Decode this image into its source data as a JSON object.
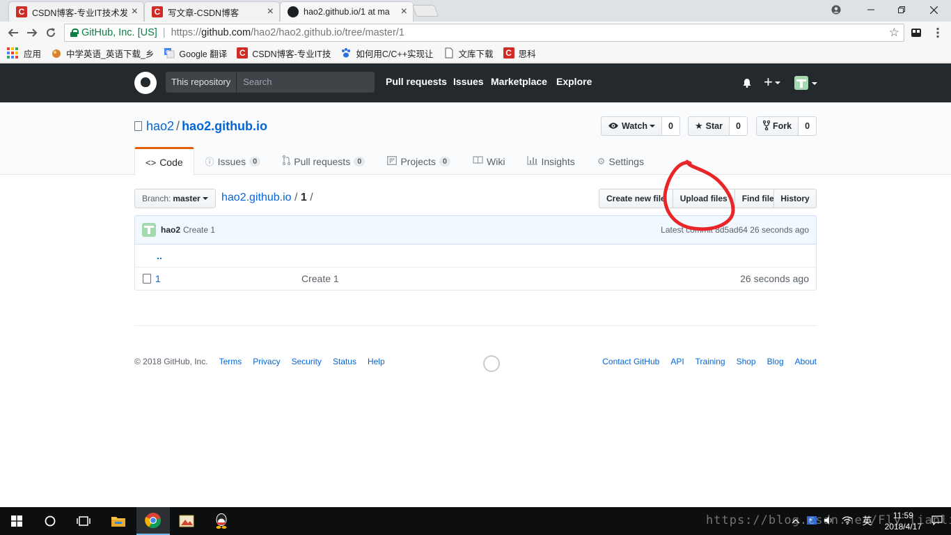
{
  "browser": {
    "tabs": [
      {
        "title": "CSDN博客-专业IT技术发",
        "favicon": "csdn-icon",
        "active": false
      },
      {
        "title": "写文章-CSDN博客",
        "favicon": "csdn-icon",
        "active": false
      },
      {
        "title": "hao2.github.io/1 at ma",
        "favicon": "github-icon",
        "active": true
      }
    ],
    "security_label": "GitHub, Inc. [US]",
    "url_scheme": "https://",
    "url_host": "github.com",
    "url_path": "/hao2/hao2.github.io/tree/master/1",
    "bookmarks": [
      {
        "label": "应用",
        "icon": "apps-grid-icon"
      },
      {
        "label": "中学英语_英语下载_乡",
        "icon": "bookmark-icon"
      },
      {
        "label": "Google 翻译",
        "icon": "google-translate-icon"
      },
      {
        "label": "CSDN博客-专业IT技",
        "icon": "csdn-icon"
      },
      {
        "label": "如何用C/C++实现让",
        "icon": "baidu-paw-icon"
      },
      {
        "label": "文库下载",
        "icon": "page-icon"
      },
      {
        "label": "思科",
        "icon": "csdn-icon"
      }
    ]
  },
  "header": {
    "scope_label": "This repository",
    "search_placeholder": "Search",
    "nav": [
      "Pull requests",
      "Issues",
      "Marketplace",
      "Explore"
    ]
  },
  "repo": {
    "owner": "hao2",
    "name": "hao2.github.io",
    "watch": {
      "label": "Watch",
      "count": "0"
    },
    "star": {
      "label": "Star",
      "count": "0"
    },
    "fork": {
      "label": "Fork",
      "count": "0"
    },
    "tabs": [
      {
        "label": "Code",
        "icon": "code-icon"
      },
      {
        "label": "Issues",
        "icon": "issue-icon",
        "count": "0"
      },
      {
        "label": "Pull requests",
        "icon": "pull-request-icon",
        "count": "0"
      },
      {
        "label": "Projects",
        "icon": "project-icon",
        "count": "0"
      },
      {
        "label": "Wiki",
        "icon": "book-icon"
      },
      {
        "label": "Insights",
        "icon": "graph-icon"
      },
      {
        "label": "Settings",
        "icon": "gear-icon"
      }
    ]
  },
  "filenav": {
    "branch_label": "Branch:",
    "branch": "master",
    "breadcrumb_root": "hao2.github.io",
    "breadcrumb_current": "1",
    "buttons": {
      "create": "Create new file",
      "upload": "Upload files",
      "find": "Find file",
      "history": "History"
    }
  },
  "commit": {
    "author": "hao2",
    "message": "Create 1",
    "latest_label": "Latest commit",
    "sha": "8d5ad64",
    "age": "26 seconds ago"
  },
  "files": {
    "up_dir": "..",
    "rows": [
      {
        "name": "1",
        "message": "Create 1",
        "age": "26 seconds ago"
      }
    ]
  },
  "footer": {
    "copyright": "© 2018 GitHub, Inc.",
    "left_links": [
      "Terms",
      "Privacy",
      "Security",
      "Status",
      "Help"
    ],
    "right_links": [
      "Contact GitHub",
      "API",
      "Training",
      "Shop",
      "Blog",
      "About"
    ]
  },
  "taskbar": {
    "time": "11:59",
    "date": "2018/4/17",
    "ime": "英",
    "watermark": "https://blog.csdn.net/Fly_lianling"
  },
  "colors": {
    "github_header": "#24292e",
    "link": "#0366d6",
    "selected_tab_border": "#e36209",
    "annotation": "#e8262a"
  }
}
